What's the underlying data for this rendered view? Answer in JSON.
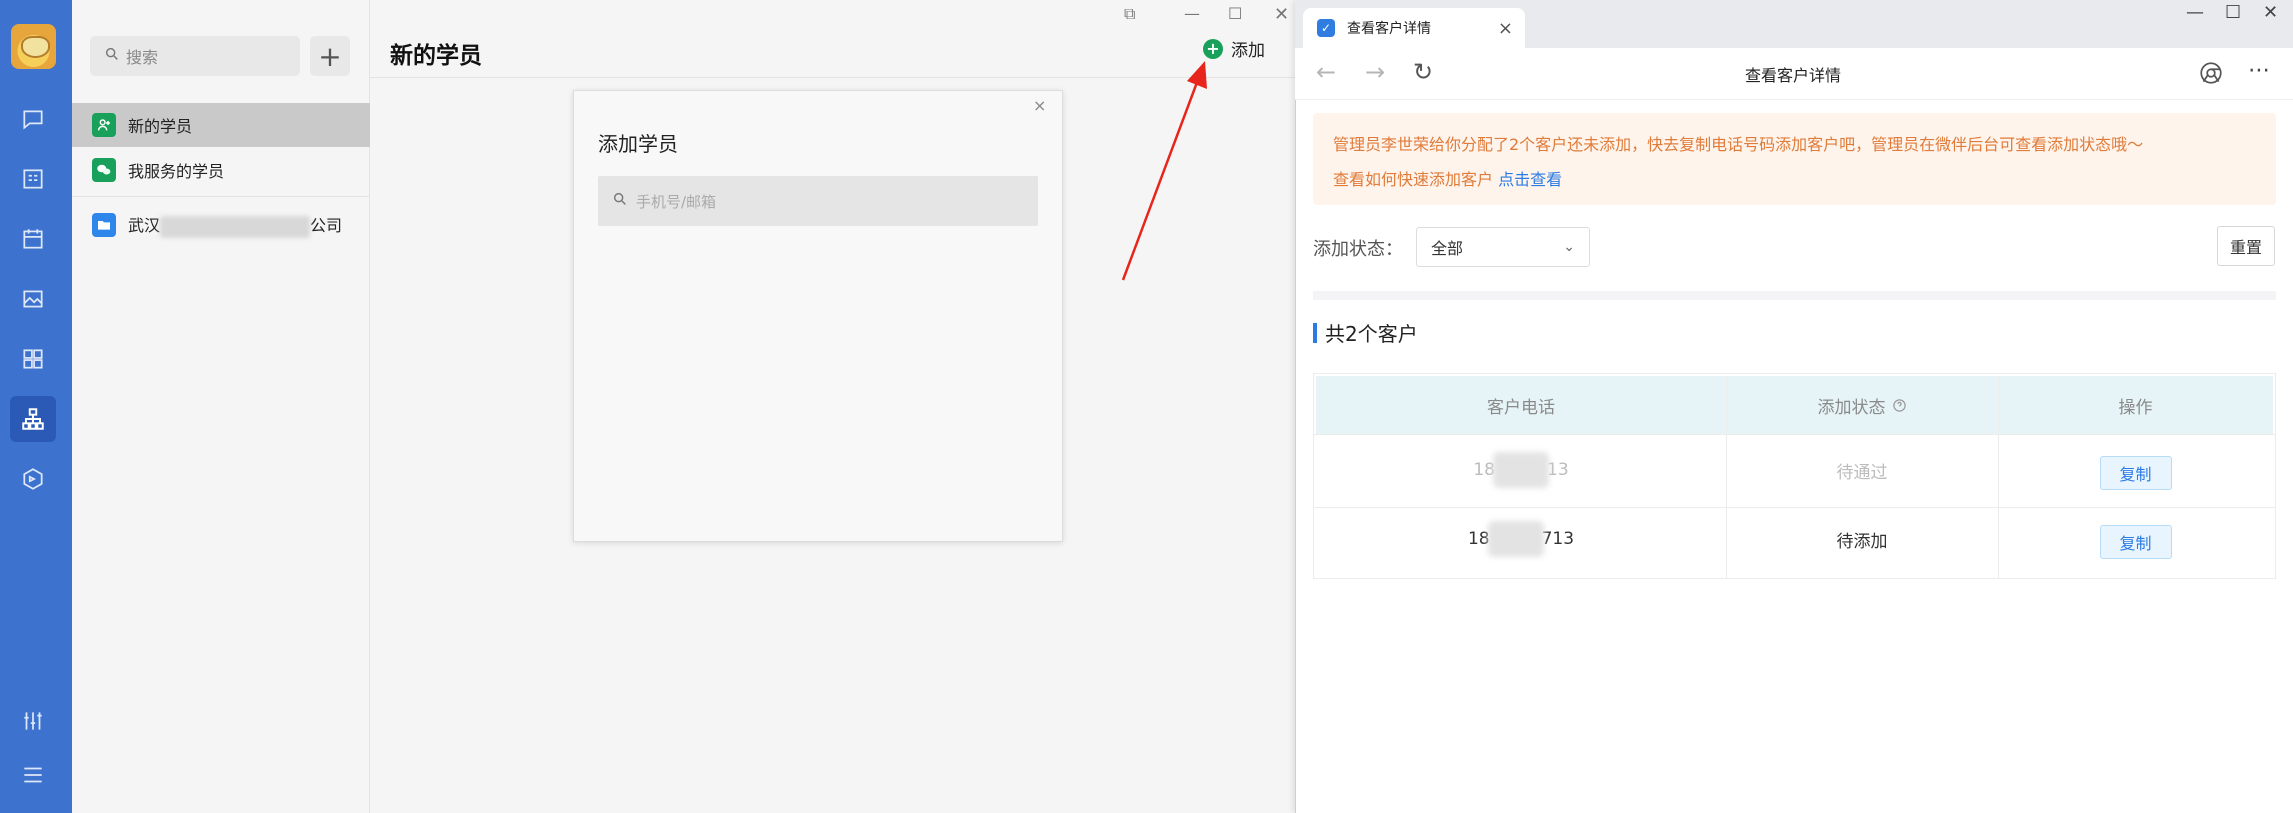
{
  "sidebar": {
    "search_placeholder": "搜索",
    "add_symbol": "+",
    "items": [
      {
        "label": "新的学员"
      },
      {
        "label": "我服务的学员"
      },
      {
        "label_start": "武汉",
        "label_end": "公司"
      }
    ]
  },
  "main": {
    "title": "新的学员",
    "add_label": "添加"
  },
  "dialog": {
    "title": "添加学员",
    "search_placeholder": "手机号/邮箱",
    "close_symbol": "×"
  },
  "browser": {
    "tab_title": "查看客户详情",
    "page_title": "查看客户详情",
    "notice_line1": "管理员李世荣给你分配了2个客户还未添加，快去复制电话号码添加客户吧，管理员在微伴后台可查看添加状态哦～",
    "notice_line2_prefix": "查看如何快速添加客户",
    "notice_link": "点击查看",
    "filter_label": "添加状态：",
    "filter_value": "全部",
    "reset_label": "重置",
    "count_label": "共2个客户",
    "table": {
      "headers": [
        "客户电话",
        "添加状态",
        "操作"
      ],
      "rows": [
        {
          "phone_prefix": "18",
          "phone_suffix": "13",
          "status": "待通过",
          "action": "复制"
        },
        {
          "phone_prefix": "18",
          "phone_suffix": "713",
          "status": "待添加",
          "action": "复制"
        }
      ]
    }
  },
  "colors": {
    "rail_blue": "#3d73ce",
    "accent_green": "#19a05b",
    "link_blue": "#2c7be5",
    "notice_orange": "#e07b3a",
    "arrow_red": "#e8251c"
  }
}
